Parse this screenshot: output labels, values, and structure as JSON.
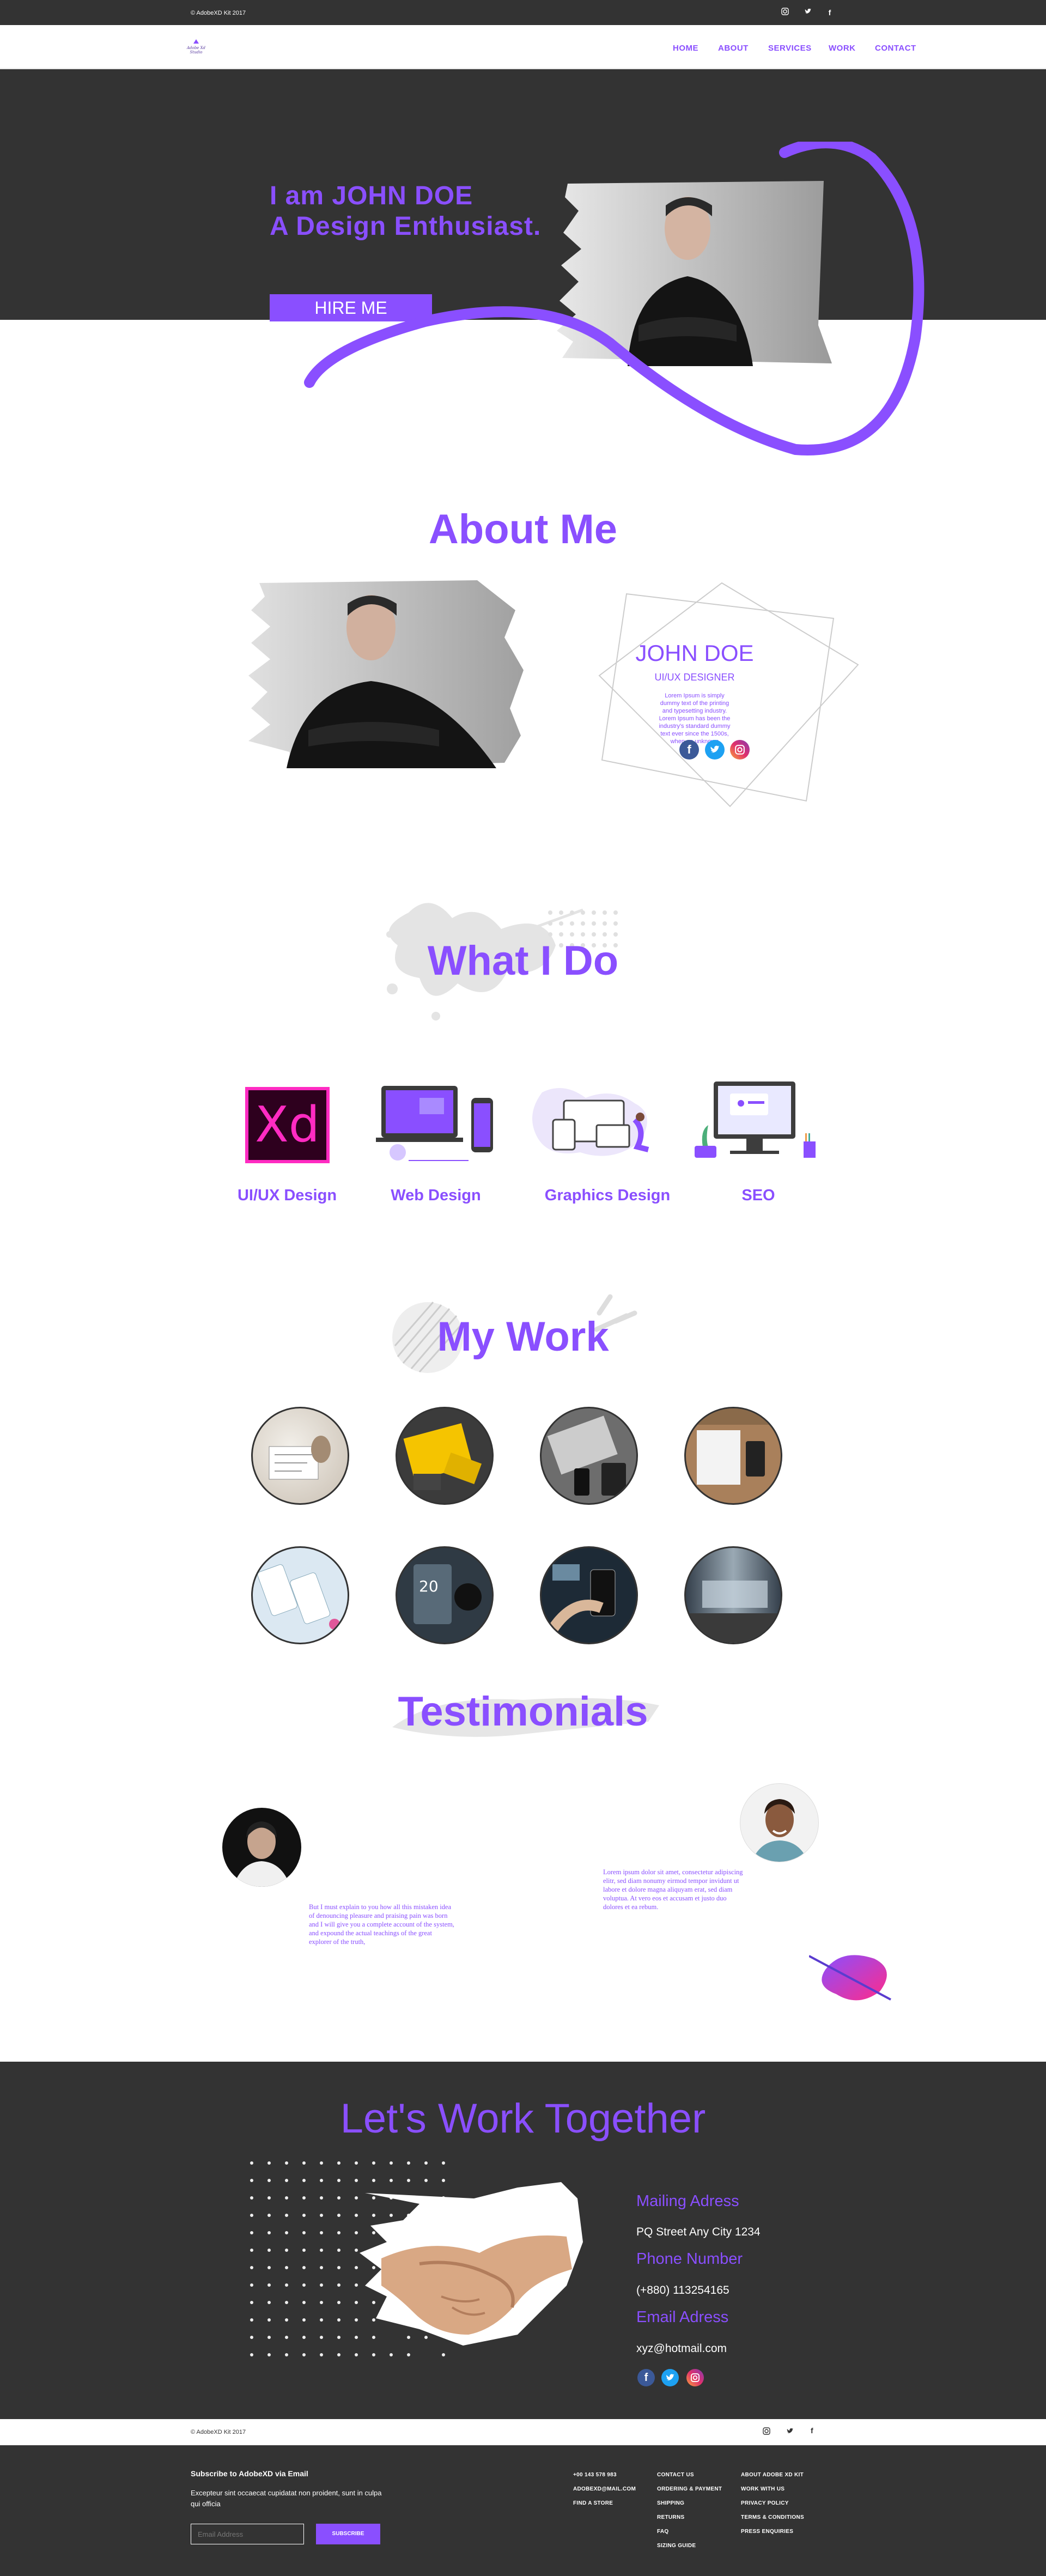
{
  "topbar": {
    "copyright": "© AdobeXD Kit 2017",
    "social": [
      "instagram-icon",
      "twitter-icon",
      "facebook-icon"
    ]
  },
  "nav": {
    "logo_text": "Adobe Xd Studio",
    "links": [
      "HOME",
      "ABOUT",
      "SERVICES",
      "WORK",
      "CONTACT"
    ]
  },
  "hero": {
    "line1": "I am JOHN DOE",
    "line2": "A Design Enthusiast.",
    "cta": "HIRE ME"
  },
  "about": {
    "title": "About Me",
    "name": "JOHN DOE",
    "role": "UI/UX DESIGNER",
    "text": "Lorem Ipsum is simply dummy text of the printing and typesetting industry. Lorem Ipsum has been the industry's standard dummy text ever since the 1500s, when an unknown"
  },
  "services": {
    "title": "What I Do",
    "items": [
      {
        "label": "UI/UX Design",
        "icon": "adobe-xd-icon",
        "glyph": "Xd"
      },
      {
        "label": "Web Design",
        "icon": "web-design-illustration"
      },
      {
        "label": "Graphics Design",
        "icon": "graphics-design-illustration"
      },
      {
        "label": "SEO",
        "icon": "seo-illustration"
      }
    ]
  },
  "work": {
    "title": "My Work",
    "count": 8
  },
  "testimonials": {
    "title": "Testimonials",
    "left_text": "But I must explain to you how all this mistaken idea of denouncing pleasure and praising pain was born and I will give you a complete account of the system, and expound the actual teachings of the great explorer of the truth,",
    "right_text": "Lorem ipsum dolor sit amet, consectetur adipiscing elitr, sed diam nonumy eirmod tempor invidunt ut labore et dolore magna aliquyam erat, sed diam voluptua. At vero eos et accusam et justo duo dolores et ea rebum."
  },
  "contact": {
    "title": "Let's Work Together",
    "mail_label": "Mailing Adress",
    "mail_value": "PQ Street Any City 1234",
    "phone_label": "Phone Number",
    "phone_value": "(+880) 113254165",
    "email_label": "Email Adress",
    "email_value": "xyz@hotmail.com"
  },
  "copybar": {
    "text": "© AdobeXD Kit 2017"
  },
  "footer": {
    "subscribe_title": "Subscribe to AdobeXD via Email",
    "subscribe_text": "Excepteur sint occaecat cupidatat non proident, sunt in culpa qui officia",
    "email_placeholder": "Email Address",
    "subscribe_btn": "SUBSCRIBE",
    "col1": [
      "+00 143 578 983",
      "ADOBEXD@MAIL.COM",
      "FIND A STORE"
    ],
    "col2": [
      "CONTACT US",
      "ORDERING & PAYMENT",
      "SHIPPING",
      "RETURNS",
      "FAQ",
      "SIZING GUIDE"
    ],
    "col3": [
      "ABOUT ADOBE XD KIT",
      "WORK WITH US",
      "PRIVACY POLICY",
      "TERMS & CONDITIONS",
      "PRESS ENQUIRIES"
    ]
  },
  "colors": {
    "accent": "#8a4fff",
    "dark": "#333333"
  }
}
